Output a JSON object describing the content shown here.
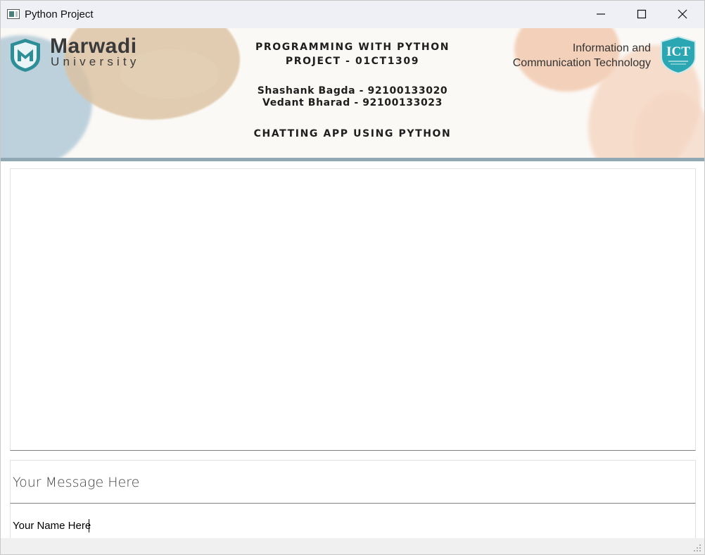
{
  "window": {
    "title": "Python Project",
    "icon": "app-window-icon",
    "controls": [
      "minimize-icon",
      "maximize-icon",
      "close-icon"
    ]
  },
  "banner": {
    "university_name": "Marwadi",
    "university_sub": "University",
    "line1": "PROGRAMMING WITH PYTHON",
    "line2": "PROJECT - 01CT1309",
    "student1": "Shashank Bagda - 92100133020",
    "student2": "Vedant Bharad - 92100133023",
    "project_title": "CHATTING APP USING PYTHON",
    "dept_line1": "Information and",
    "dept_line2": "Communication Technology",
    "dept_badge": "ICT",
    "colors": {
      "shield": "#2e8e98",
      "badge": "#2aa7b2",
      "rule": "#8fa8b4"
    }
  },
  "chat": {
    "messages": []
  },
  "message_input": {
    "placeholder": "Your Message Here",
    "value": ""
  },
  "name_input": {
    "value": "Your Name Here"
  }
}
